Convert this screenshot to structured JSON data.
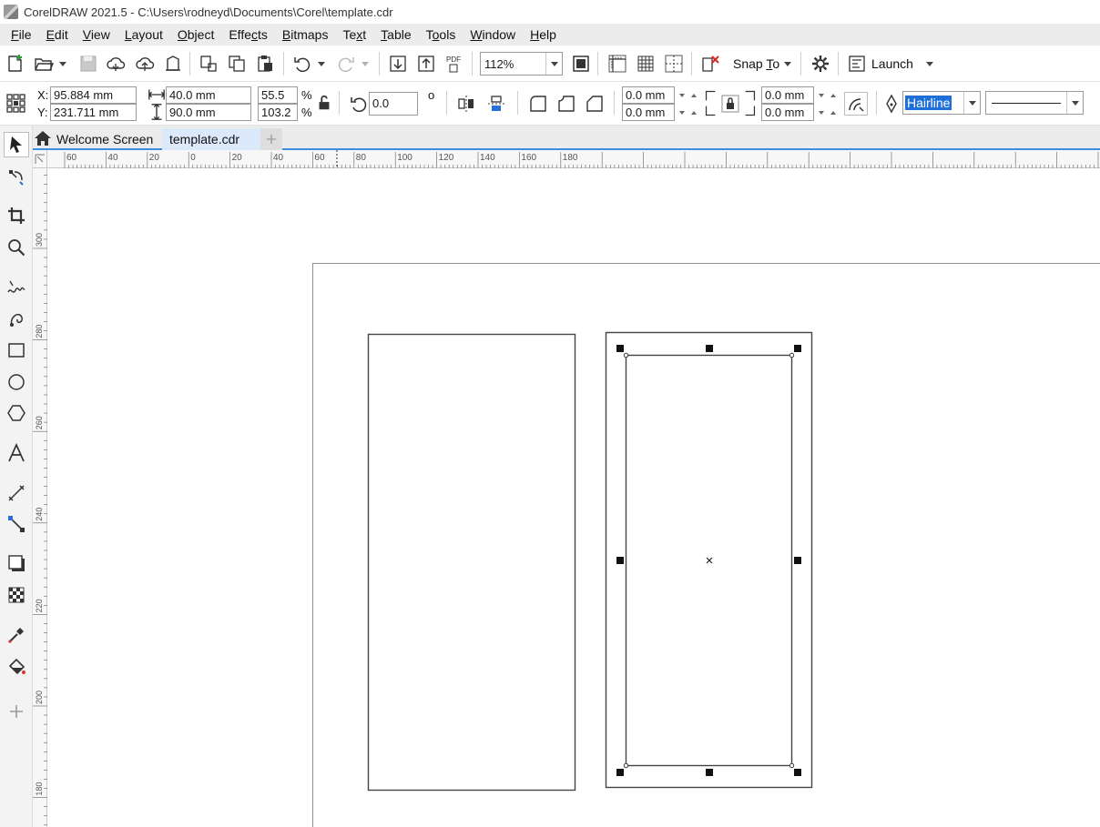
{
  "window": {
    "title": "CorelDRAW 2021.5 - C:\\Users\\rodneyd\\Documents\\Corel\\template.cdr"
  },
  "menu": [
    {
      "pre": "",
      "ul": "F",
      "post": "ile"
    },
    {
      "pre": "",
      "ul": "E",
      "post": "dit"
    },
    {
      "pre": "",
      "ul": "V",
      "post": "iew"
    },
    {
      "pre": "",
      "ul": "L",
      "post": "ayout"
    },
    {
      "pre": "",
      "ul": "O",
      "post": "bject"
    },
    {
      "pre": "Effe",
      "ul": "c",
      "post": "ts"
    },
    {
      "pre": "",
      "ul": "B",
      "post": "itmaps"
    },
    {
      "pre": "Te",
      "ul": "x",
      "post": "t"
    },
    {
      "pre": "",
      "ul": "T",
      "post": "able"
    },
    {
      "pre": "T",
      "ul": "o",
      "post": "ols"
    },
    {
      "pre": "",
      "ul": "W",
      "post": "indow"
    },
    {
      "pre": "",
      "ul": "H",
      "post": "elp"
    }
  ],
  "standard_toolbar": {
    "zoom": "112%",
    "snap_to": {
      "pre": "Snap ",
      "ul": "T",
      "post": "o"
    },
    "launch": "Launch"
  },
  "property_bar": {
    "x_label": "X:",
    "x_value": "95.884 mm",
    "y_label": "Y:",
    "y_value": "231.711 mm",
    "width": "40.0 mm",
    "height": "90.0 mm",
    "scale_x": "55.5",
    "scale_y": "103.2",
    "percent": "%",
    "rotation": "0.0",
    "degree": "o",
    "corner_tl": "0.0 mm",
    "corner_bl": "0.0 mm",
    "corner_tr": "0.0 mm",
    "corner_br": "0.0 mm",
    "outline_width": "Hairline"
  },
  "tabs": [
    {
      "label": "Welcome Screen"
    },
    {
      "label": "template.cdr"
    }
  ],
  "rulers": {
    "h_ticks": [
      "60",
      "40",
      "20",
      "0",
      "20",
      "40",
      "60",
      "80",
      "100",
      "120",
      "140",
      "160",
      "180"
    ],
    "v_ticks": [
      "300",
      "280",
      "260",
      "240",
      "220",
      "200",
      "180"
    ]
  }
}
